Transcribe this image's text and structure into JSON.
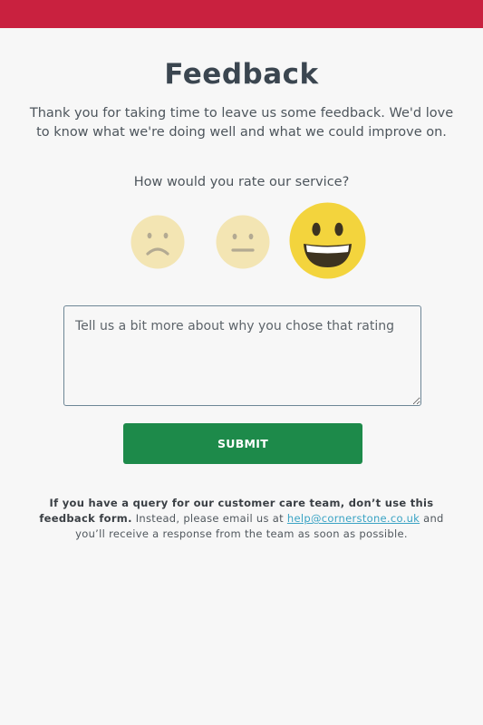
{
  "header": {
    "bar_color": "#c9213f"
  },
  "page": {
    "title": "Feedback",
    "intro": "Thank you for taking time to leave us some feedback. We'd love to know what we're doing well and what we could improve on."
  },
  "rating": {
    "question": "How would you rate our service?",
    "options": [
      {
        "name": "sad",
        "icon": "sad-face-icon",
        "selected": false
      },
      {
        "name": "neutral",
        "icon": "neutral-face-icon",
        "selected": false
      },
      {
        "name": "happy",
        "icon": "grinning-face-icon",
        "selected": true
      }
    ]
  },
  "comment": {
    "placeholder": "Tell us a bit more about why you chose that rating",
    "value": ""
  },
  "submit": {
    "label": "SUBMIT",
    "color": "#1d8a4a"
  },
  "notice": {
    "bold": "If you have a query for our customer care team, don’t use this feedback form.",
    "text_before": " Instead, please email us at ",
    "email": "help@cornerstone.co.uk",
    "text_after": " and you’ll receive a response from the team as soon as possible."
  }
}
